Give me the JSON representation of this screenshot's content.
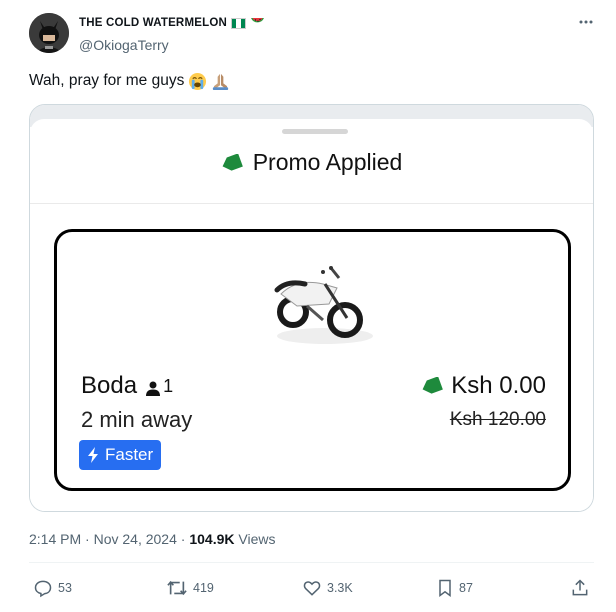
{
  "author": {
    "display_name": "THE COLD WATERMELON",
    "handle": "@OkiogaTerry",
    "flag_icon": "nigeria-flag-icon",
    "watermelon_icon": "watermelon-icon"
  },
  "tweet": {
    "text": "Wah, pray for me guys",
    "emojis": [
      "loudly-crying-face-icon",
      "folded-hands-icon"
    ]
  },
  "screenshot": {
    "header_title": "Promo Applied",
    "ride": {
      "name": "Boda",
      "seats": "1",
      "eta": "2 min away",
      "badge": "Faster",
      "price": "Ksh 0.00",
      "original_price": "Ksh 120.00"
    }
  },
  "meta": {
    "time": "2:14 PM",
    "separator": "·",
    "date": "Nov 24, 2024",
    "views_count": "104.9K",
    "views_label": "Views"
  },
  "actions": {
    "replies": "53",
    "reposts": "419",
    "likes": "3.3K",
    "bookmarks": "87"
  },
  "colors": {
    "promo_tag": "#1e8a3c",
    "faster_badge": "#276ef1",
    "secondary_text": "#536471"
  }
}
